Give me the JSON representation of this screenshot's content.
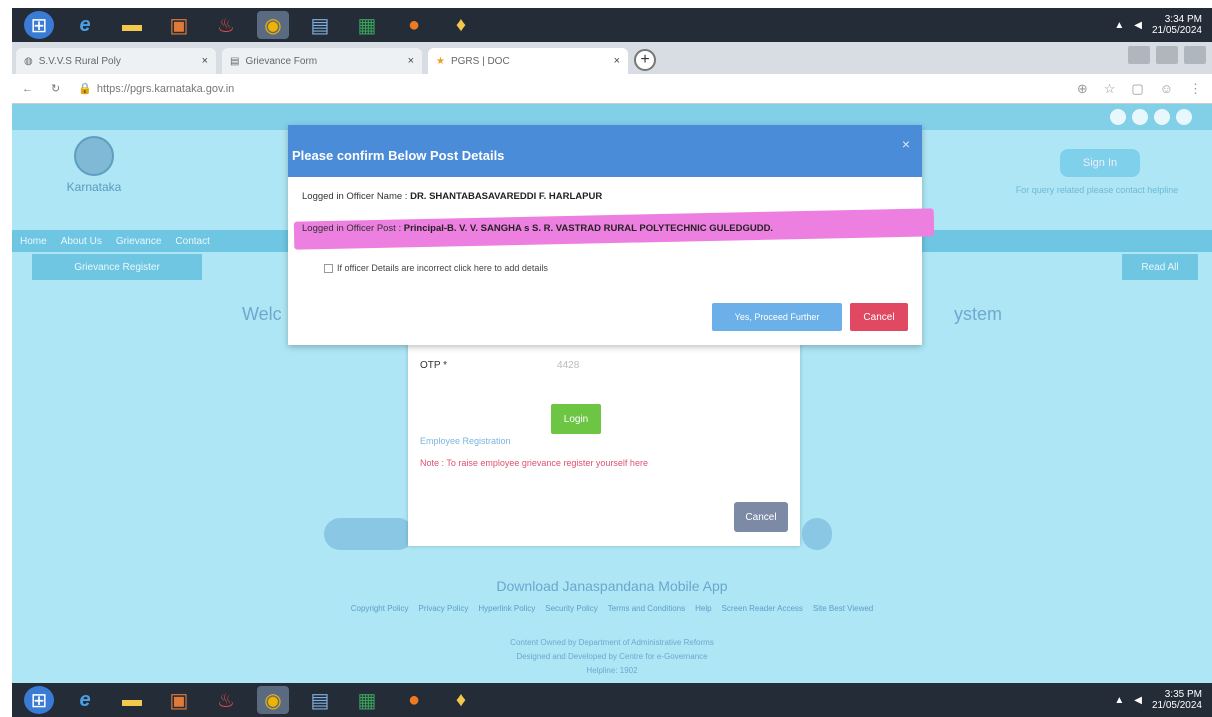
{
  "taskbar_top": {
    "icons": [
      "firefox-menu-icon",
      "ie-icon",
      "folder-icon",
      "media-icon",
      "paint-icon",
      "chrome-icon",
      "notes-icon",
      "excel-icon",
      "firefox-icon",
      "app-icon"
    ],
    "clock_time": "3:34 PM",
    "clock_date": "21/05/2024"
  },
  "taskbar_bottom": {
    "clock_time": "3:35 PM",
    "clock_date": "21/05/2024"
  },
  "browser": {
    "tabs": [
      {
        "label": "S.V.V.S Rural Poly",
        "close": "×"
      },
      {
        "label": "Grievance Form",
        "close": "×"
      },
      {
        "label": "PGRS | DOC",
        "close": "×"
      }
    ],
    "url": "https://pgrs.karnataka.gov.in"
  },
  "page": {
    "logo_text": "Karnataka",
    "signin": "Sign In",
    "help": "For query related please contact helpline",
    "nav_items": [
      "Home",
      "About Us",
      "Grievance",
      "Contact"
    ],
    "subnav": "Grievance Register",
    "read_all": "Read All",
    "welcome_left": "Welc",
    "welcome_right": "ystem",
    "download_app": "Download Janaspandana Mobile App",
    "footer_links": [
      "Copyright Policy",
      "Privacy Policy",
      "Hyperlink Policy",
      "Security Policy",
      "Terms and Conditions",
      "Help",
      "Screen Reader Access",
      "Site Best Viewed"
    ],
    "footer_line1": "Content Owned by Department of Administrative Reforms",
    "footer_line2": "Designed and Developed by Centre for e-Governance",
    "footer_line3": "Helpline: 1902"
  },
  "login_panel": {
    "otp_label": "OTP *",
    "otp_value": "4428",
    "login_button": "Login",
    "employee_registration": "Employee Registration",
    "note": "Note : To raise employee grievance register yourself here",
    "cancel_button": "Cancel"
  },
  "modal": {
    "title": "Please confirm Below Post Details",
    "close": "×",
    "officer_name_label": "Logged in Officer Name : ",
    "officer_name": "DR. SHANTABASAVAREDDI F. HARLAPUR",
    "officer_post_label": "Logged in Officer Post : ",
    "officer_post": "Principal-B. V. V. SANGHA s S. R. VASTRAD RURAL POLYTECHNIC GULEDGUDD.",
    "incorrect_text": "If officer Details are incorrect click here to add details",
    "proceed_button": "Yes, Proceed Further",
    "cancel_button": "Cancel",
    "highlight_color": "#ed7fe0"
  }
}
